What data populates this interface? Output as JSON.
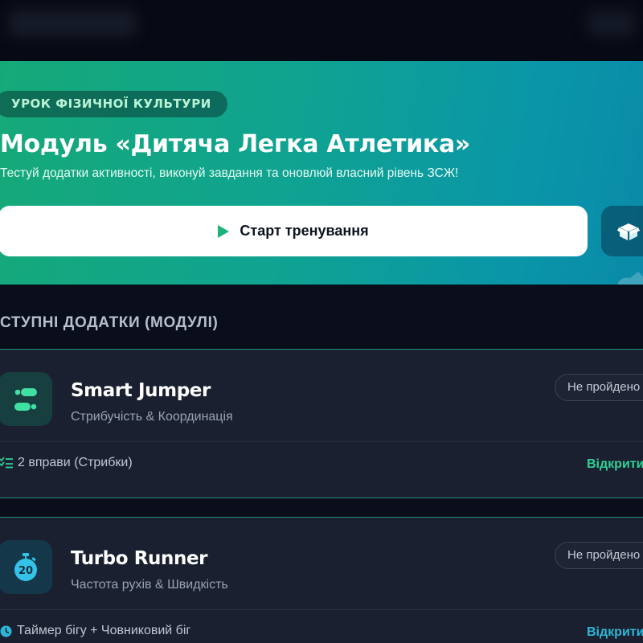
{
  "hero": {
    "badge": "УРОК ФІЗИЧНОЇ КУЛЬТУРИ",
    "title": "Модуль «Дитяча Легка Атлетика»",
    "subtitle": "Тестуй додатки активності, виконуй завдання та оновлюй власний рівень ЗСЖ!",
    "start_button": "Старт тренування",
    "start_icon": "play-icon",
    "side_icon": "box-icon"
  },
  "section": {
    "title": "СТУПНІ ДОДАТКИ (МОДУЛІ)"
  },
  "modules": [
    {
      "name": "Smart Jumper",
      "description": "Стрибучість & Координація",
      "status": "Не пройдено",
      "meta": "2 вправи (Стрибки)",
      "meta_icon": "checklist-icon",
      "action": "Відкрити",
      "icon": "footprints-icon"
    },
    {
      "name": "Turbo Runner",
      "description": "Частота рухів & Швидкість",
      "status": "Не пройдено",
      "meta": "Таймер бігу + Човниковий біг",
      "meta_icon": "clock-icon",
      "action": "Відкрити",
      "icon": "stopwatch-icon",
      "icon_number": "20"
    }
  ],
  "colors": {
    "accent_green": "#2ed197",
    "accent_cyan": "#2bb8d6",
    "hero_start": "#16a978",
    "hero_end": "#0a8aa8",
    "background": "#0a0e1a",
    "card": "#1a2030"
  }
}
